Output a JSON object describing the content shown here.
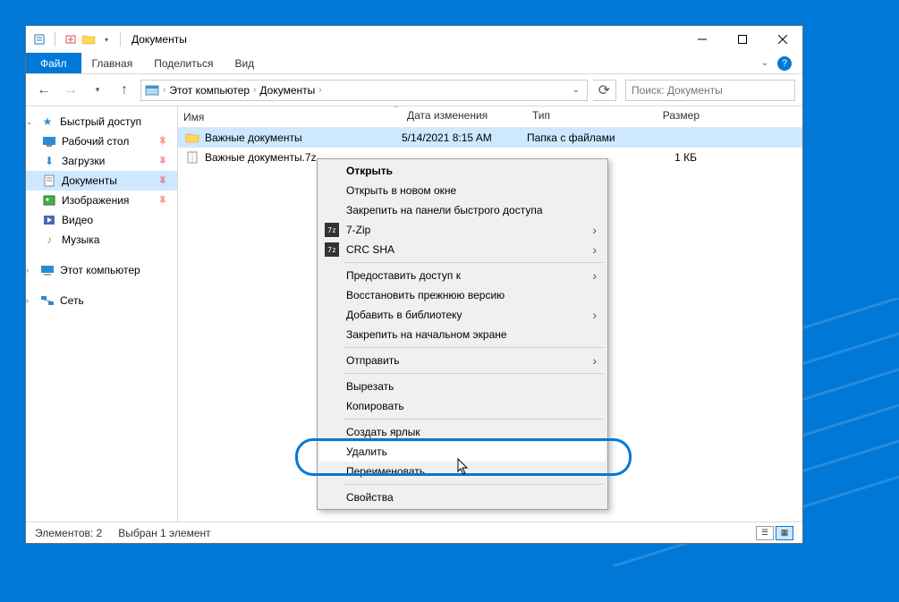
{
  "titlebar": {
    "title": "Документы"
  },
  "ribbon": {
    "file": "Файл",
    "tabs": [
      "Главная",
      "Поделиться",
      "Вид"
    ]
  },
  "breadcrumb": {
    "items": [
      "Этот компьютер",
      "Документы"
    ]
  },
  "search": {
    "placeholder": "Поиск: Документы"
  },
  "sidebar": {
    "quick_access": "Быстрый доступ",
    "items": [
      {
        "label": "Рабочий стол",
        "icon": "desktop",
        "pinned": true
      },
      {
        "label": "Загрузки",
        "icon": "downloads",
        "pinned": true
      },
      {
        "label": "Документы",
        "icon": "documents",
        "pinned": true,
        "selected": true
      },
      {
        "label": "Изображения",
        "icon": "pictures",
        "pinned": true
      },
      {
        "label": "Видео",
        "icon": "videos",
        "pinned": false
      },
      {
        "label": "Музыка",
        "icon": "music",
        "pinned": false
      }
    ],
    "this_pc": "Этот компьютер",
    "network": "Сеть"
  },
  "columns": {
    "name": "Имя",
    "date": "Дата изменения",
    "type": "Тип",
    "size": "Размер"
  },
  "files": [
    {
      "name": "Важные документы",
      "date": "5/14/2021 8:15 AM",
      "type": "Папка с файлами",
      "size": "",
      "icon": "folder",
      "selected": true
    },
    {
      "name": "Важные документы.7z",
      "date": "",
      "type": "",
      "size": "1 КБ",
      "icon": "archive",
      "selected": false
    }
  ],
  "statusbar": {
    "count": "Элементов: 2",
    "selection": "Выбран 1 элемент"
  },
  "context_menu": {
    "open": "Открыть",
    "open_new": "Открыть в новом окне",
    "pin_qa": "Закрепить на панели быстрого доступа",
    "sevenzip": "7-Zip",
    "crcsha": "CRC SHA",
    "grant_access": "Предоставить доступ к",
    "restore": "Восстановить прежнюю версию",
    "add_library": "Добавить в библиотеку",
    "pin_start": "Закрепить на начальном экране",
    "send_to": "Отправить",
    "cut": "Вырезать",
    "copy": "Копировать",
    "create_shortcut": "Создать ярлык",
    "delete": "Удалить",
    "rename": "Переименовать",
    "properties": "Свойства",
    "icon_7z": "7z"
  }
}
